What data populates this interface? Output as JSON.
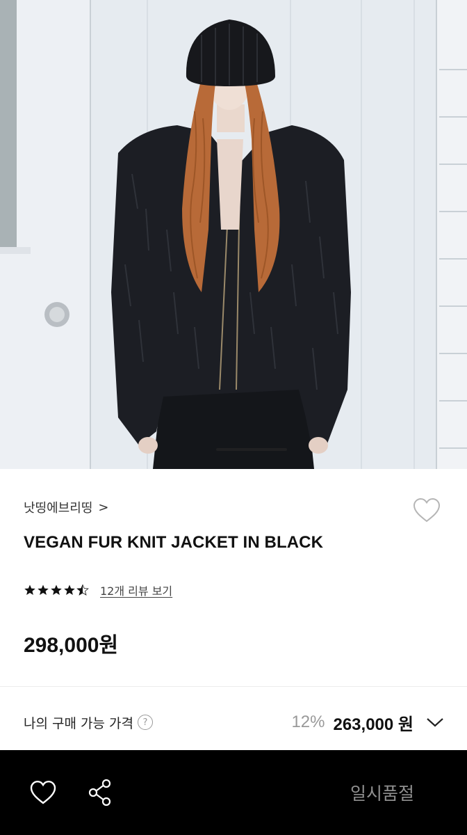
{
  "hero": {
    "image_description": "",
    "slide_indicator": "active"
  },
  "product": {
    "brand": "낫띵에브리띵",
    "brand_chevron": ">",
    "title": "VEGAN FUR KNIT JACKET IN BLACK",
    "rating": 4.5,
    "review_link": "12개 리뷰 보기",
    "price": "298,000원",
    "wishlisted": false
  },
  "my_price": {
    "label": "나의 구매 가능 가격",
    "help_glyph": "?",
    "discount_rate": "12%",
    "price": "263,000 원"
  },
  "bottom_bar": {
    "sold_out_label": "일시품절"
  },
  "colors": {
    "accent_black": "#000000",
    "muted_text": "#999999",
    "disabled_text": "#8f8f8f"
  }
}
